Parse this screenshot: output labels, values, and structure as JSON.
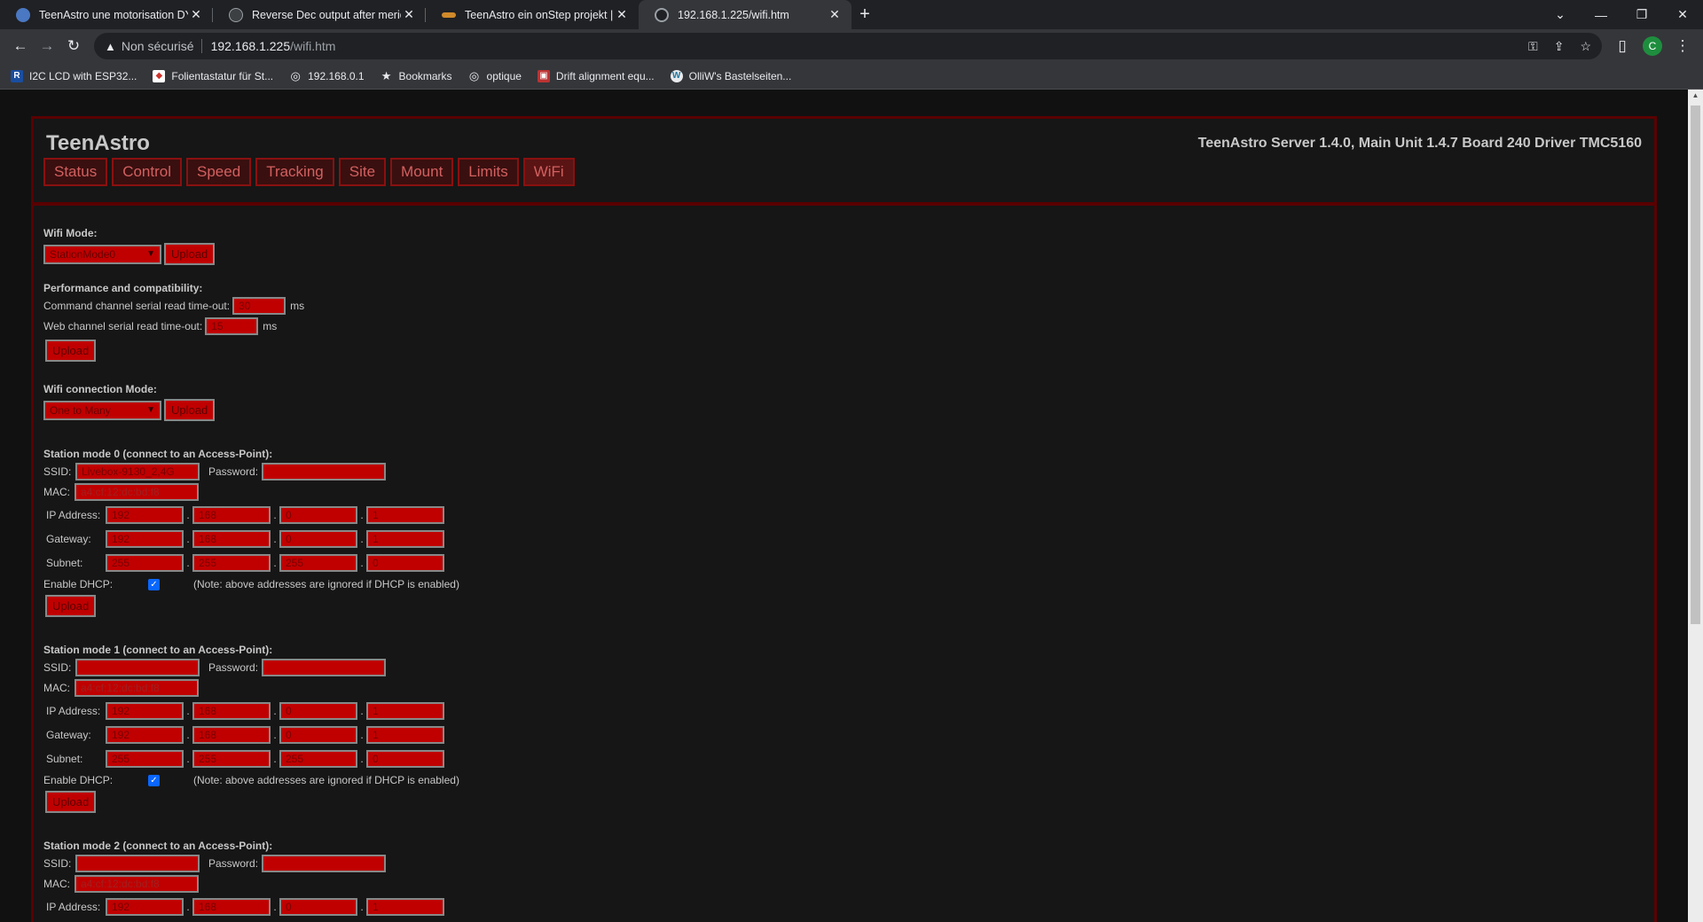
{
  "browser": {
    "tabs": [
      {
        "label": "TeenAstro une motorisation DYI",
        "favicon_color": "#4a78c2"
      },
      {
        "label": "Reverse Dec output after meridia",
        "favicon_color": "#9aa0a6"
      },
      {
        "label": "TeenAstro ein onStep projekt | Se",
        "favicon_color": "#d08a2a"
      },
      {
        "label": "192.168.1.225/wifi.htm",
        "favicon_color": "#9aa0a6"
      }
    ],
    "address": {
      "insecure_label": "Non sécurisé",
      "host": "192.168.1.225",
      "path": "/wifi.htm"
    },
    "avatar_letter": "C",
    "bookmarks": [
      {
        "label": "I2C LCD with ESP32...",
        "icon": "R"
      },
      {
        "label": "Folientastatur für St...",
        "icon": "◆"
      },
      {
        "label": "192.168.0.1",
        "icon": "◎"
      },
      {
        "label": "Bookmarks",
        "icon": "★"
      },
      {
        "label": "optique",
        "icon": "◎"
      },
      {
        "label": "Drift alignment equ...",
        "icon": "▣"
      },
      {
        "label": "OlliW's Bastelseiten...",
        "icon": "W"
      }
    ]
  },
  "page": {
    "brand": "TeenAstro",
    "version": "TeenAstro Server 1.4.0, Main Unit 1.4.7 Board 240 Driver TMC5160",
    "menu": [
      "Status",
      "Control",
      "Speed",
      "Tracking",
      "Site",
      "Mount",
      "Limits",
      "WiFi"
    ],
    "wifi_mode": {
      "label": "Wifi Mode:",
      "value": "StationMode0",
      "upload": "Upload"
    },
    "perf": {
      "title": "Performance and compatibility:",
      "cmd_label": "Command channel serial read time-out:",
      "cmd_value": "30",
      "web_label": "Web channel serial read time-out:",
      "web_value": "15",
      "unit": "ms",
      "upload": "Upload"
    },
    "conn_mode": {
      "label": "Wifi connection Mode:",
      "value": "One to Many",
      "upload": "Upload"
    },
    "labels": {
      "ssid": "SSID:",
      "password": "Password:",
      "mac": "MAC:",
      "ip": "IP Address:",
      "gateway": "Gateway:",
      "subnet": "Subnet:",
      "dhcp": "Enable DHCP:",
      "dhcp_note": "(Note: above addresses are ignored if DHCP is enabled)",
      "dot": ".",
      "upload": "Upload"
    },
    "stations": [
      {
        "title": "Station mode 0 (connect to an Access-Point):",
        "ssid": "Livebox-9130_2,4G",
        "password": "",
        "mac": "a4:cf:12:dc:bd:f8",
        "ip": [
          "192",
          "168",
          "0",
          "1"
        ],
        "gateway": [
          "192",
          "168",
          "0",
          "1"
        ],
        "subnet": [
          "255",
          "255",
          "255",
          "0"
        ],
        "dhcp": true
      },
      {
        "title": "Station mode 1 (connect to an Access-Point):",
        "ssid": "",
        "password": "",
        "mac": "a4:cf:12:dc:bd:f8",
        "ip": [
          "192",
          "168",
          "0",
          "1"
        ],
        "gateway": [
          "192",
          "168",
          "0",
          "1"
        ],
        "subnet": [
          "255",
          "255",
          "255",
          "0"
        ],
        "dhcp": true
      },
      {
        "title": "Station mode 2 (connect to an Access-Point):",
        "ssid": "",
        "password": "",
        "mac": "a4:cf:12:dc:bd:f8",
        "ip": [
          "192",
          "168",
          "0",
          "1"
        ]
      }
    ]
  }
}
